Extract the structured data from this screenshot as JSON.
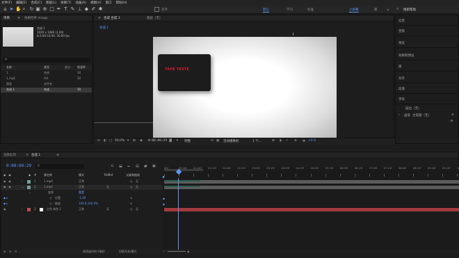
{
  "menu": [
    "文件(F)",
    "编辑(E)",
    "合成(C)",
    "图层(L)",
    "效果(T)",
    "动画(A)",
    "视图(V)",
    "窗口",
    "帮助(H)"
  ],
  "toolbar": {
    "workspaces": [
      "默认",
      "学习",
      "标准",
      "小屏幕",
      "库"
    ],
    "active_workspace": "默认",
    "search_placeholder": "搜索帮助",
    "snap_label": "对齐"
  },
  "project": {
    "tab": "项目",
    "effect_tab": "效果控件 image",
    "preview_name": "合成 1",
    "preview_info1": "1920 x 1080 (1.00)",
    "preview_info2": "Δ 0:00:10:00, 30.00 fps",
    "search": "ρ.",
    "columns": [
      "名称",
      "类型",
      "大小",
      "帧速率"
    ],
    "items": [
      {
        "name": "1",
        "type": "合成",
        "size": "",
        "fps": "30"
      },
      {
        "name": "1.mp4",
        "type": "AVI",
        "size": "",
        "fps": "30"
      },
      {
        "name": "固态",
        "type": "文件夹",
        "size": "",
        "fps": ""
      },
      {
        "name": "合成 1",
        "type": "合成",
        "size": "",
        "fps": "30"
      }
    ]
  },
  "viewer": {
    "tab_comp": "合成 合成 1",
    "tab_layer": "图层（无）",
    "breadcrumb": "合成 1",
    "title_text": "TAPE TEXTE",
    "zoom": "50.0%",
    "timecode": "0:00:00:29",
    "quality": "完整",
    "camera": "活动摄像机",
    "views": "1 个...",
    "exposure": "+0.0"
  },
  "right_panel": {
    "items": [
      "信息",
      "音频",
      "预览",
      "效果和预设",
      "库",
      "对齐",
      "段落",
      "字符",
      "描边（无）",
      "画笔"
    ],
    "brush_sub": "主笔图（无）"
  },
  "timeline": {
    "tab_render": "渲染队列",
    "tab_comp": "合成 1",
    "timecode": "0:00:00:29",
    "search": "ρ.",
    "columns": {
      "source": "源名称",
      "mode": "模式",
      "trkmat": "TrkMat",
      "parent": "父级和链接"
    },
    "ruler": [
      "00f",
      "00:15f",
      "01:00f",
      "01:15f",
      "02:00f",
      "02:15f",
      "03:00f",
      "03:15f",
      "04:00f",
      "04:15f",
      "05:00f",
      "05:15f",
      "06:00f",
      "06:15f",
      "07:00f",
      "07:15f",
      "08:00f",
      "08:15f",
      "09:00f",
      "09:15f",
      "10:0"
    ],
    "layers": [
      {
        "num": "1",
        "name": "1.mp4",
        "mode": "正常",
        "trkmat": "",
        "parent": "无"
      },
      {
        "num": "2",
        "name": "1.mp4",
        "mode": "正常",
        "trkmat": "无",
        "parent": "无"
      },
      {
        "num": "",
        "name": "变换",
        "mode": "重置",
        "trkmat": "",
        "parent": ""
      },
      {
        "num": "",
        "name": "位置",
        "mode": "-1.00",
        "trkmat": "",
        "parent": ""
      },
      {
        "num": "",
        "name": "缩放",
        "mode": "100.0,100.0%",
        "trkmat": "",
        "parent": ""
      },
      {
        "num": "3",
        "name": "白色 纯色 1",
        "mode": "正常",
        "trkmat": "无",
        "parent": "无"
      }
    ],
    "footer": "帧渲染时间 0毫秒",
    "footer_toggle": "切换开关/模式"
  },
  "colors": {
    "accent": "#5b95ff",
    "solid_red": "#a33a3f",
    "video_green": "#2e5e52",
    "text_red": "#d81a38"
  }
}
